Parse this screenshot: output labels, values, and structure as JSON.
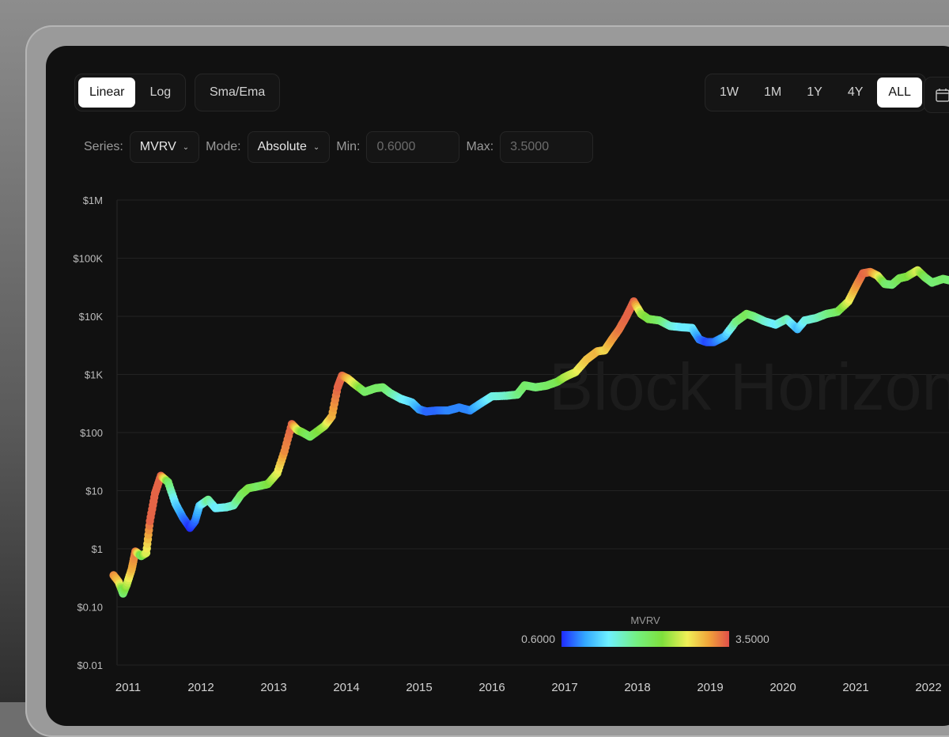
{
  "toolbar": {
    "scale_buttons": [
      "Linear",
      "Log"
    ],
    "scale_active": "Linear",
    "sma_label": "Sma/Ema",
    "range_buttons": [
      "1W",
      "1M",
      "1Y",
      "4Y",
      "ALL"
    ],
    "range_active": "ALL"
  },
  "controls": {
    "series_label": "Series:",
    "series_value": "MVRV",
    "mode_label": "Mode:",
    "mode_value": "Absolute",
    "min_label": "Min:",
    "min_value": "0.6000",
    "max_label": "Max:",
    "max_value": "3.5000"
  },
  "watermark": "Block Horizon",
  "colors": {
    "background": "#111111",
    "grid": "#262626",
    "scale": [
      "#1f2bff",
      "#33a8ff",
      "#6ef0ff",
      "#74f080",
      "#7ee03c",
      "#f0f057",
      "#f0a33a",
      "#e0504a"
    ]
  },
  "chart_data": {
    "type": "scatter",
    "yscale": "log",
    "ylim": [
      0.01,
      1000000
    ],
    "xlim": [
      2010.85,
      2022.5
    ],
    "yticks": [
      {
        "v": 1000000,
        "label": "$1M"
      },
      {
        "v": 100000,
        "label": "$100K"
      },
      {
        "v": 10000,
        "label": "$10K"
      },
      {
        "v": 1000,
        "label": "$1K"
      },
      {
        "v": 100,
        "label": "$100"
      },
      {
        "v": 10,
        "label": "$10"
      },
      {
        "v": 1,
        "label": "$1"
      },
      {
        "v": 0.1,
        "label": "$0.10"
      },
      {
        "v": 0.01,
        "label": "$0.01"
      }
    ],
    "xticks": [
      "2011",
      "2012",
      "2013",
      "2014",
      "2015",
      "2016",
      "2017",
      "2018",
      "2019",
      "2020",
      "2021",
      "2022"
    ],
    "colorbar": {
      "title": "MVRV",
      "min_label": "0.6000",
      "max_label": "3.5000",
      "min": 0.6,
      "max": 3.5
    },
    "series": [
      {
        "points": [
          [
            2010.8,
            0.35,
            3.2
          ],
          [
            2010.87,
            0.27,
            2.9
          ],
          [
            2010.93,
            0.17,
            1.9
          ],
          [
            2010.98,
            0.24,
            2.4
          ],
          [
            2011.05,
            0.45,
            3.0
          ],
          [
            2011.1,
            0.9,
            3.3
          ],
          [
            2011.18,
            0.75,
            2.0
          ],
          [
            2011.25,
            0.85,
            2.6
          ],
          [
            2011.3,
            3.0,
            3.4
          ],
          [
            2011.37,
            9.0,
            3.4
          ],
          [
            2011.45,
            18,
            3.4
          ],
          [
            2011.55,
            14,
            2.0
          ],
          [
            2011.65,
            6.0,
            1.3
          ],
          [
            2011.75,
            3.5,
            0.9
          ],
          [
            2011.85,
            2.3,
            0.6
          ],
          [
            2011.92,
            3.0,
            0.8
          ],
          [
            2011.98,
            5.5,
            1.2
          ],
          [
            2012.1,
            7.0,
            1.8
          ],
          [
            2012.2,
            5.0,
            1.4
          ],
          [
            2012.35,
            5.2,
            1.5
          ],
          [
            2012.45,
            5.6,
            1.6
          ],
          [
            2012.55,
            8.5,
            2.0
          ],
          [
            2012.65,
            11,
            2.2
          ],
          [
            2012.8,
            12,
            2.0
          ],
          [
            2012.92,
            13,
            2.2
          ],
          [
            2013.05,
            20,
            2.6
          ],
          [
            2013.15,
            48,
            3.2
          ],
          [
            2013.25,
            140,
            3.4
          ],
          [
            2013.33,
            110,
            2.6
          ],
          [
            2013.4,
            100,
            2.2
          ],
          [
            2013.5,
            85,
            2.0
          ],
          [
            2013.6,
            105,
            2.2
          ],
          [
            2013.7,
            130,
            2.4
          ],
          [
            2013.8,
            190,
            3.0
          ],
          [
            2013.88,
            600,
            3.4
          ],
          [
            2013.94,
            950,
            3.4
          ],
          [
            2014.02,
            850,
            3.0
          ],
          [
            2014.1,
            700,
            2.6
          ],
          [
            2014.25,
            500,
            2.0
          ],
          [
            2014.4,
            580,
            2.0
          ],
          [
            2014.5,
            600,
            2.0
          ],
          [
            2014.6,
            480,
            1.8
          ],
          [
            2014.75,
            380,
            1.5
          ],
          [
            2014.9,
            330,
            1.3
          ],
          [
            2015.0,
            250,
            1.0
          ],
          [
            2015.1,
            230,
            0.8
          ],
          [
            2015.25,
            240,
            0.8
          ],
          [
            2015.4,
            240,
            0.9
          ],
          [
            2015.55,
            270,
            0.9
          ],
          [
            2015.7,
            240,
            0.9
          ],
          [
            2015.85,
            320,
            1.2
          ],
          [
            2016.0,
            420,
            1.5
          ],
          [
            2016.2,
            430,
            1.6
          ],
          [
            2016.35,
            450,
            1.8
          ],
          [
            2016.45,
            650,
            2.0
          ],
          [
            2016.6,
            600,
            1.9
          ],
          [
            2016.75,
            640,
            2.0
          ],
          [
            2016.9,
            750,
            2.1
          ],
          [
            2017.0,
            900,
            2.4
          ],
          [
            2017.15,
            1100,
            2.6
          ],
          [
            2017.3,
            1800,
            2.9
          ],
          [
            2017.45,
            2500,
            3.0
          ],
          [
            2017.55,
            2600,
            2.8
          ],
          [
            2017.65,
            4000,
            3.1
          ],
          [
            2017.75,
            6000,
            3.3
          ],
          [
            2017.85,
            10000,
            3.4
          ],
          [
            2017.95,
            18000,
            3.4
          ],
          [
            2018.05,
            11000,
            2.4
          ],
          [
            2018.15,
            9000,
            2.2
          ],
          [
            2018.3,
            8500,
            2.0
          ],
          [
            2018.45,
            6800,
            1.6
          ],
          [
            2018.6,
            6500,
            1.4
          ],
          [
            2018.75,
            6300,
            1.4
          ],
          [
            2018.85,
            4000,
            0.9
          ],
          [
            2018.95,
            3600,
            0.7
          ],
          [
            2019.05,
            3600,
            0.8
          ],
          [
            2019.2,
            4500,
            1.1
          ],
          [
            2019.35,
            8000,
            1.8
          ],
          [
            2019.5,
            11000,
            2.1
          ],
          [
            2019.6,
            10000,
            1.9
          ],
          [
            2019.75,
            8200,
            1.6
          ],
          [
            2019.9,
            7200,
            1.4
          ],
          [
            2020.05,
            9000,
            1.7
          ],
          [
            2020.2,
            6000,
            1.1
          ],
          [
            2020.3,
            8500,
            1.5
          ],
          [
            2020.45,
            9300,
            1.6
          ],
          [
            2020.6,
            11000,
            1.8
          ],
          [
            2020.75,
            12000,
            2.0
          ],
          [
            2020.9,
            18000,
            2.6
          ],
          [
            2021.0,
            32000,
            3.1
          ],
          [
            2021.1,
            55000,
            3.4
          ],
          [
            2021.2,
            58000,
            3.3
          ],
          [
            2021.3,
            50000,
            2.8
          ],
          [
            2021.4,
            36000,
            2.0
          ],
          [
            2021.5,
            35000,
            1.9
          ],
          [
            2021.6,
            45000,
            2.1
          ],
          [
            2021.7,
            48000,
            2.2
          ],
          [
            2021.85,
            62000,
            2.6
          ],
          [
            2021.95,
            47000,
            2.1
          ],
          [
            2022.05,
            38000,
            1.9
          ],
          [
            2022.2,
            44000,
            2.0
          ],
          [
            2022.35,
            40000,
            1.9
          ],
          [
            2022.5,
            42000,
            2.0
          ]
        ]
      }
    ]
  }
}
